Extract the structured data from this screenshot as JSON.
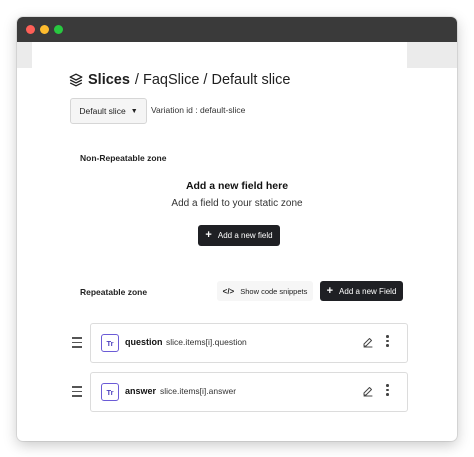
{
  "breadcrumb": {
    "root": "Slices",
    "path": "/ FaqSlice / Default slice"
  },
  "variation": {
    "selector_label": "Default slice",
    "id_text": "Variation id : default-slice"
  },
  "non_repeatable": {
    "label": "Non-Repeatable zone",
    "empty_title": "Add a new field here",
    "empty_subtitle": "Add a field to your static zone",
    "add_button_label": "Add a new field"
  },
  "repeatable": {
    "label": "Repeatable zone",
    "snippets_button_label": "Show code snippets",
    "add_button_label": "Add a new Field",
    "fields": [
      {
        "icon_text": "Tr",
        "name": "question",
        "path": "slice.items[i].question"
      },
      {
        "icon_text": "Tr",
        "name": "answer",
        "path": "slice.items[i].answer"
      }
    ]
  },
  "icons": {
    "breadcrumb": "layers-icon",
    "drag": "drag-handle-icon",
    "edit": "pencil-icon",
    "more": "more-vertical-icon",
    "code": "code-icon",
    "add": "plus-icon",
    "dropdown": "chevron-down-icon"
  },
  "colors": {
    "dark_button": "#1f2024",
    "field_icon": "#6b5bd6",
    "titlebar": "#3a3a3a"
  }
}
